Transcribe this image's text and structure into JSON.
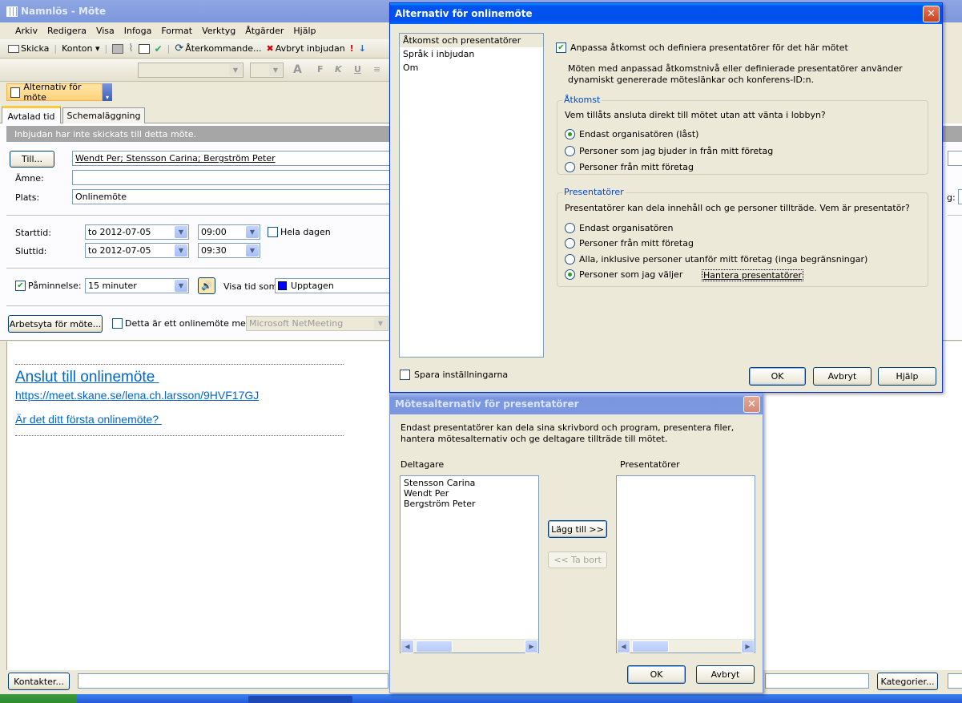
{
  "window": {
    "title": "Namnlös - Möte"
  },
  "menu": [
    "Arkiv",
    "Redigera",
    "Visa",
    "Infoga",
    "Format",
    "Verktyg",
    "Åtgärder",
    "Hjälp"
  ],
  "toolbar": {
    "send": "Skicka",
    "account": "Konton",
    "recurring": "Återkommande...",
    "cancel_invite": "Avbryt inbjudan"
  },
  "addin_toolbar": {
    "online_options": "Alternativ för möte"
  },
  "tabs": [
    "Avtalad tid",
    "Schemaläggning"
  ],
  "form": {
    "info_bar": "Inbjudan har inte skickats till detta möte.",
    "to_button": "Till...",
    "to_value": "Wendt Per; Stensson Carina; Bergström Peter",
    "subject_label": "Ämne:",
    "subject_value": "",
    "location_label": "Plats:",
    "location_value": "Onlinemöte",
    "start_label": "Starttid:",
    "start_date": "to 2012-07-05",
    "start_time": "09:00",
    "allday_label": "Hela dagen",
    "end_label": "Sluttid:",
    "end_date": "to 2012-07-05",
    "end_time": "09:30",
    "reminder_label": "Påminnelse:",
    "reminder_value": "15 minuter",
    "showas_label": "Visa tid som:",
    "showas_value": "Upptagen",
    "workspace_button": "Arbetsyta för möte...",
    "online_meeting_label": "Detta är ett onlinemöte med:",
    "online_meeting_value": "Microsoft NetMeeting",
    "partial_label_right": "g:"
  },
  "body": {
    "join_link": "Anslut till onlinemöte",
    "url": "https://meet.skane.se/lena.ch.larsson/9HVF17GJ",
    "first_time": "Är det ditt första onlinemöte?"
  },
  "footer": {
    "contacts_button": "Kontakter...",
    "categories_button": "Kategorier..."
  },
  "dialog1": {
    "title": "Alternativ för onlinemöte",
    "nav_items": [
      "Åtkomst och presentatörer",
      "Språk i inbjudan",
      "Om"
    ],
    "save_settings": "Spara inställningarna",
    "customize_label": "Anpassa åtkomst och definiera presentatörer för det här mötet",
    "customize_desc": "Möten med anpassad åtkomstnivå eller definierade presentatörer använder dynamiskt genererade möteslänkar och konferens-ID:n.",
    "access_group": "Åtkomst",
    "access_question": "Vem tillåts ansluta direkt till mötet utan att vänta i lobbyn?",
    "access_options": [
      "Endast organisatören (låst)",
      "Personer som jag bjuder in från mitt företag",
      "Personer från mitt företag"
    ],
    "presenters_group": "Presentatörer",
    "presenters_question": "Presentatörer kan dela innehåll och ge personer tillträde. Vem är presentatör?",
    "presenter_options": [
      "Endast organisatören",
      "Personer från mitt företag",
      "Alla, inklusive personer utanför mitt företag (inga begränsningar)",
      "Personer som jag väljer"
    ],
    "manage_presenters": "Hantera presentatörer",
    "ok": "OK",
    "cancel": "Avbryt",
    "help": "Hjälp"
  },
  "dialog2": {
    "title": "Mötesalternativ för presentatörer",
    "description": "Endast presentatörer kan dela sina skrivbord och program, presentera filer, hantera mötesalternativ och ge deltagare tillträde till mötet.",
    "participants_label": "Deltagare",
    "participants": [
      "Stensson Carina",
      "Wendt Per",
      "Bergström Peter"
    ],
    "presenters_label": "Presentatörer",
    "presenters": [],
    "add_button": "Lägg till >>",
    "remove_button": "<< Ta bort",
    "ok": "OK",
    "cancel": "Avbryt"
  }
}
